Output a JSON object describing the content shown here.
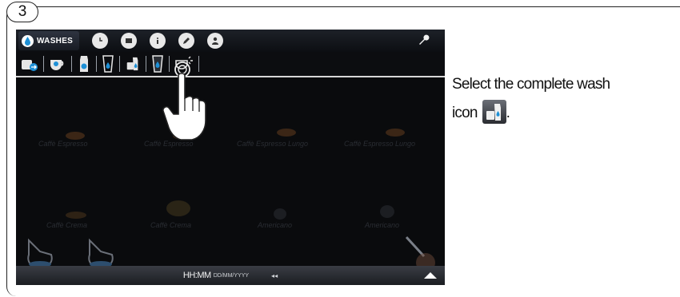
{
  "step": {
    "number": "3"
  },
  "toolbar": {
    "washes_label": "WASHES",
    "icons": [
      "clock-icon",
      "flag-icon",
      "info-icon",
      "pencil-icon",
      "user-icon"
    ],
    "settings_icon": "wrench-icon"
  },
  "wash_bar": {
    "items": [
      "milk-circuit-wash-icon",
      "cup-wash-icon",
      "carafe-wash-icon",
      "glass-wash-icon",
      "complete-wash-icon",
      "glass-drop-wash-icon",
      "steam-wash-icon"
    ],
    "selected": "complete-wash-icon"
  },
  "background_products": {
    "row1": [
      "Caffè Espresso",
      "Caffè Espresso",
      "Caffè Espresso Lungo",
      "Caffè Espresso Lungo"
    ],
    "row2": [
      "Caffè Crema",
      "Caffè Crema",
      "Americano",
      "Americano"
    ]
  },
  "status_bar": {
    "time": "HH:MM",
    "date": "DD/MM/YYYY",
    "volume": "◂◂"
  },
  "instruction": {
    "line1": "Select the complete wash",
    "line2_prefix": "icon",
    "line2_suffix": "."
  },
  "colors": {
    "screen_background": "#0a0b0d",
    "accent": "#1e90d6",
    "frame": "#222222"
  }
}
